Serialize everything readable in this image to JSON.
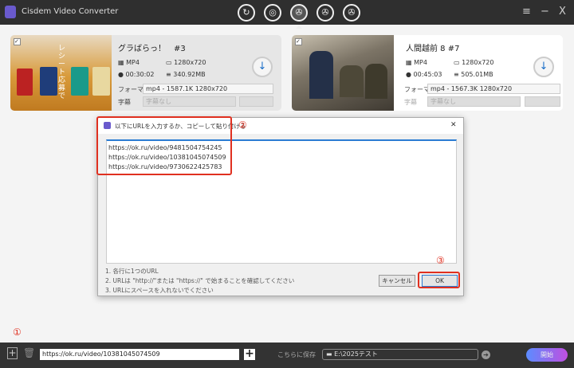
{
  "app": {
    "title": "Cisdem Video Converter",
    "modes": [
      "convert",
      "rip",
      "download",
      "compress",
      "edit"
    ],
    "menu": "≡",
    "minimize": "−",
    "close": "X"
  },
  "videos": [
    {
      "title": "グラばらっ！　#3",
      "format": "MP4",
      "resolution": "1280x720",
      "duration": "00:30:02",
      "size": "340.92MB",
      "format_label": "フォーマ",
      "format_value": "mp4 - 1587.1K 1280x720",
      "subtitle_label": "字幕",
      "subtitle_value": "字幕なし",
      "thumb_text": "レシート応募で"
    },
    {
      "title": "人間越前 8 #7",
      "format": "MP4",
      "resolution": "1280x720",
      "duration": "00:45:03",
      "size": "505.01MB",
      "format_label": "フォーマ",
      "format_value": "mp4 - 1567.3K 1280x720",
      "subtitle_label": "字幕",
      "subtitle_value": "字幕なし"
    }
  ],
  "dialog": {
    "title": "以下にURLを入力するか、コピーして貼り付ける",
    "close": "✕",
    "urls": "https://ok.ru/video/9481504754245\nhttps://ok.ru/video/10381045074509\nhttps://ok.ru/video/9730622425783",
    "hints": [
      "1. 各行に1つのURL",
      "2. URLは \"http://\"または \"https://\" で始まることを確認してください",
      "3. URLにスペースを入れないでください"
    ],
    "cancel": "キャンセル",
    "ok": "OK"
  },
  "annotations": [
    "①",
    "②",
    "③"
  ],
  "bottom": {
    "url_value": "https://ok.ru/video/10381045074509",
    "save_label": "こちらに保存",
    "save_path": "E:\\2025テスト",
    "start": "開始"
  },
  "colors": {
    "accent": "#1a6ec8",
    "highlight": "#e03020",
    "start_gradient": [
      "#5b8cff",
      "#c04fe0"
    ]
  }
}
